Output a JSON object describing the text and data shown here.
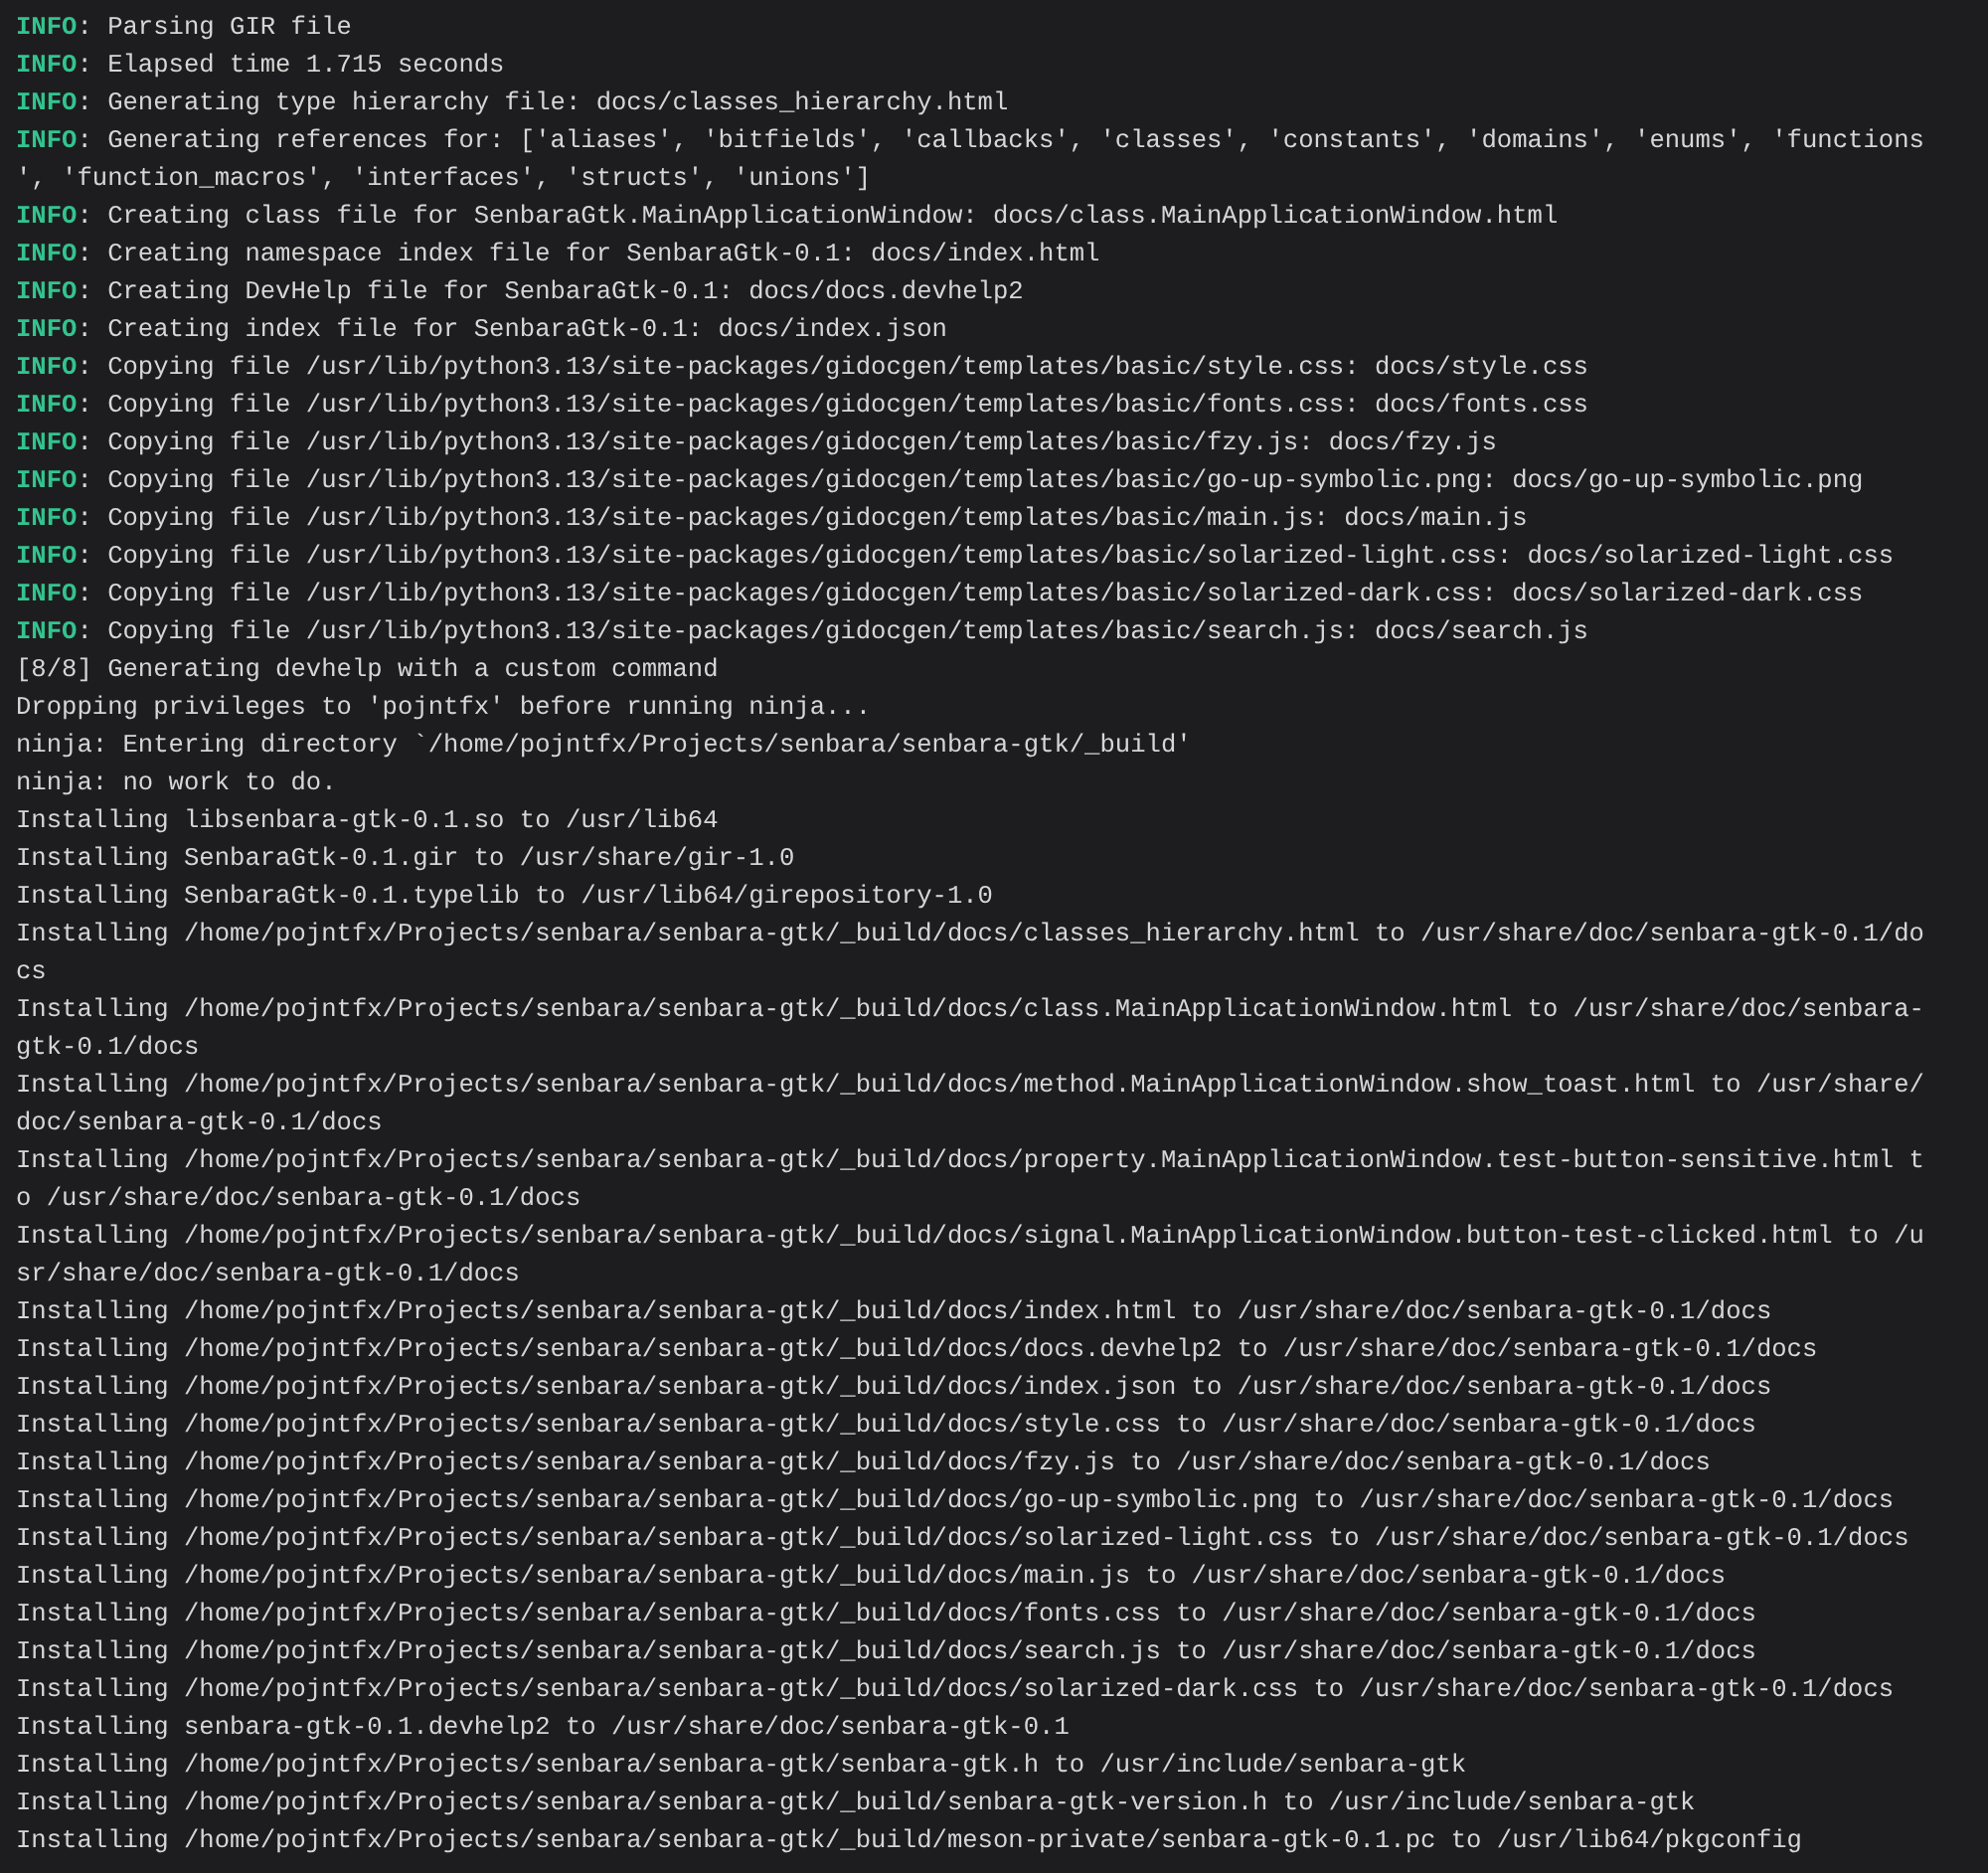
{
  "terminal": {
    "lines": [
      {
        "kind": "info",
        "tag": "INFO",
        "text": ": Parsing GIR file"
      },
      {
        "kind": "info",
        "tag": "INFO",
        "text": ": Elapsed time 1.715 seconds"
      },
      {
        "kind": "info",
        "tag": "INFO",
        "text": ": Generating type hierarchy file: docs/classes_hierarchy.html"
      },
      {
        "kind": "info",
        "tag": "INFO",
        "text": ": Generating references for: ['aliases', 'bitfields', 'callbacks', 'classes', 'constants', 'domains', 'enums', 'functions"
      },
      {
        "kind": "plain",
        "text": "', 'function_macros', 'interfaces', 'structs', 'unions']"
      },
      {
        "kind": "info",
        "tag": "INFO",
        "text": ": Creating class file for SenbaraGtk.MainApplicationWindow: docs/class.MainApplicationWindow.html"
      },
      {
        "kind": "info",
        "tag": "INFO",
        "text": ": Creating namespace index file for SenbaraGtk-0.1: docs/index.html"
      },
      {
        "kind": "info",
        "tag": "INFO",
        "text": ": Creating DevHelp file for SenbaraGtk-0.1: docs/docs.devhelp2"
      },
      {
        "kind": "info",
        "tag": "INFO",
        "text": ": Creating index file for SenbaraGtk-0.1: docs/index.json"
      },
      {
        "kind": "info",
        "tag": "INFO",
        "text": ": Copying file /usr/lib/python3.13/site-packages/gidocgen/templates/basic/style.css: docs/style.css"
      },
      {
        "kind": "info",
        "tag": "INFO",
        "text": ": Copying file /usr/lib/python3.13/site-packages/gidocgen/templates/basic/fonts.css: docs/fonts.css"
      },
      {
        "kind": "info",
        "tag": "INFO",
        "text": ": Copying file /usr/lib/python3.13/site-packages/gidocgen/templates/basic/fzy.js: docs/fzy.js"
      },
      {
        "kind": "info",
        "tag": "INFO",
        "text": ": Copying file /usr/lib/python3.13/site-packages/gidocgen/templates/basic/go-up-symbolic.png: docs/go-up-symbolic.png"
      },
      {
        "kind": "info",
        "tag": "INFO",
        "text": ": Copying file /usr/lib/python3.13/site-packages/gidocgen/templates/basic/main.js: docs/main.js"
      },
      {
        "kind": "info",
        "tag": "INFO",
        "text": ": Copying file /usr/lib/python3.13/site-packages/gidocgen/templates/basic/solarized-light.css: docs/solarized-light.css"
      },
      {
        "kind": "info",
        "tag": "INFO",
        "text": ": Copying file /usr/lib/python3.13/site-packages/gidocgen/templates/basic/solarized-dark.css: docs/solarized-dark.css"
      },
      {
        "kind": "info",
        "tag": "INFO",
        "text": ": Copying file /usr/lib/python3.13/site-packages/gidocgen/templates/basic/search.js: docs/search.js"
      },
      {
        "kind": "plain",
        "text": "[8/8] Generating devhelp with a custom command"
      },
      {
        "kind": "plain",
        "text": "Dropping privileges to 'pojntfx' before running ninja..."
      },
      {
        "kind": "plain",
        "text": "ninja: Entering directory `/home/pojntfx/Projects/senbara/senbara-gtk/_build'"
      },
      {
        "kind": "plain",
        "text": "ninja: no work to do."
      },
      {
        "kind": "plain",
        "text": "Installing libsenbara-gtk-0.1.so to /usr/lib64"
      },
      {
        "kind": "plain",
        "text": "Installing SenbaraGtk-0.1.gir to /usr/share/gir-1.0"
      },
      {
        "kind": "plain",
        "text": "Installing SenbaraGtk-0.1.typelib to /usr/lib64/girepository-1.0"
      },
      {
        "kind": "plain",
        "text": "Installing /home/pojntfx/Projects/senbara/senbara-gtk/_build/docs/classes_hierarchy.html to /usr/share/doc/senbara-gtk-0.1/do"
      },
      {
        "kind": "plain",
        "text": "cs"
      },
      {
        "kind": "plain",
        "text": "Installing /home/pojntfx/Projects/senbara/senbara-gtk/_build/docs/class.MainApplicationWindow.html to /usr/share/doc/senbara-"
      },
      {
        "kind": "plain",
        "text": "gtk-0.1/docs"
      },
      {
        "kind": "plain",
        "text": "Installing /home/pojntfx/Projects/senbara/senbara-gtk/_build/docs/method.MainApplicationWindow.show_toast.html to /usr/share/"
      },
      {
        "kind": "plain",
        "text": "doc/senbara-gtk-0.1/docs"
      },
      {
        "kind": "plain",
        "text": "Installing /home/pojntfx/Projects/senbara/senbara-gtk/_build/docs/property.MainApplicationWindow.test-button-sensitive.html t"
      },
      {
        "kind": "plain",
        "text": "o /usr/share/doc/senbara-gtk-0.1/docs"
      },
      {
        "kind": "plain",
        "text": "Installing /home/pojntfx/Projects/senbara/senbara-gtk/_build/docs/signal.MainApplicationWindow.button-test-clicked.html to /u"
      },
      {
        "kind": "plain",
        "text": "sr/share/doc/senbara-gtk-0.1/docs"
      },
      {
        "kind": "plain",
        "text": "Installing /home/pojntfx/Projects/senbara/senbara-gtk/_build/docs/index.html to /usr/share/doc/senbara-gtk-0.1/docs"
      },
      {
        "kind": "plain",
        "text": "Installing /home/pojntfx/Projects/senbara/senbara-gtk/_build/docs/docs.devhelp2 to /usr/share/doc/senbara-gtk-0.1/docs"
      },
      {
        "kind": "plain",
        "text": "Installing /home/pojntfx/Projects/senbara/senbara-gtk/_build/docs/index.json to /usr/share/doc/senbara-gtk-0.1/docs"
      },
      {
        "kind": "plain",
        "text": "Installing /home/pojntfx/Projects/senbara/senbara-gtk/_build/docs/style.css to /usr/share/doc/senbara-gtk-0.1/docs"
      },
      {
        "kind": "plain",
        "text": "Installing /home/pojntfx/Projects/senbara/senbara-gtk/_build/docs/fzy.js to /usr/share/doc/senbara-gtk-0.1/docs"
      },
      {
        "kind": "plain",
        "text": "Installing /home/pojntfx/Projects/senbara/senbara-gtk/_build/docs/go-up-symbolic.png to /usr/share/doc/senbara-gtk-0.1/docs"
      },
      {
        "kind": "plain",
        "text": "Installing /home/pojntfx/Projects/senbara/senbara-gtk/_build/docs/solarized-light.css to /usr/share/doc/senbara-gtk-0.1/docs"
      },
      {
        "kind": "plain",
        "text": "Installing /home/pojntfx/Projects/senbara/senbara-gtk/_build/docs/main.js to /usr/share/doc/senbara-gtk-0.1/docs"
      },
      {
        "kind": "plain",
        "text": "Installing /home/pojntfx/Projects/senbara/senbara-gtk/_build/docs/fonts.css to /usr/share/doc/senbara-gtk-0.1/docs"
      },
      {
        "kind": "plain",
        "text": "Installing /home/pojntfx/Projects/senbara/senbara-gtk/_build/docs/search.js to /usr/share/doc/senbara-gtk-0.1/docs"
      },
      {
        "kind": "plain",
        "text": "Installing /home/pojntfx/Projects/senbara/senbara-gtk/_build/docs/solarized-dark.css to /usr/share/doc/senbara-gtk-0.1/docs"
      },
      {
        "kind": "plain",
        "text": "Installing senbara-gtk-0.1.devhelp2 to /usr/share/doc/senbara-gtk-0.1"
      },
      {
        "kind": "plain",
        "text": "Installing /home/pojntfx/Projects/senbara/senbara-gtk/senbara-gtk.h to /usr/include/senbara-gtk"
      },
      {
        "kind": "plain",
        "text": "Installing /home/pojntfx/Projects/senbara/senbara-gtk/_build/senbara-gtk-version.h to /usr/include/senbara-gtk"
      },
      {
        "kind": "plain",
        "text": "Installing /home/pojntfx/Projects/senbara/senbara-gtk/_build/meson-private/senbara-gtk-0.1.pc to /usr/lib64/pkgconfig"
      }
    ]
  }
}
